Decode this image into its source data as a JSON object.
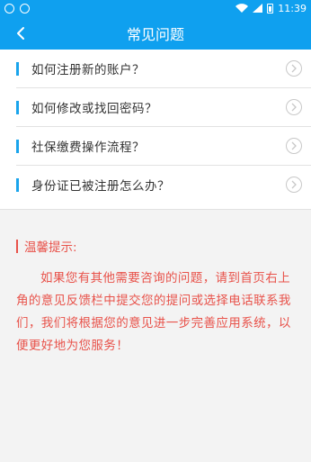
{
  "status_bar": {
    "time": "11:39"
  },
  "header": {
    "title": "常见问题",
    "back_icon": "chevron-left-icon"
  },
  "faq": {
    "items": [
      {
        "label": "如何注册新的账户？"
      },
      {
        "label": "如何修改或找回密码？"
      },
      {
        "label": "社保缴费操作流程？"
      },
      {
        "label": "身份证已被注册怎么办？"
      }
    ]
  },
  "tips": {
    "title": "温馨提示:",
    "body": "如果您有其他需要咨询的问题，请到首页右上角的意见反馈栏中提交您的提问或选择电话联系我们，我们将根据您的意见进一步完善应用系统，以便更好地为您服务！"
  },
  "colors": {
    "accent": "#0fa0ef",
    "tip": "#e8524a"
  }
}
